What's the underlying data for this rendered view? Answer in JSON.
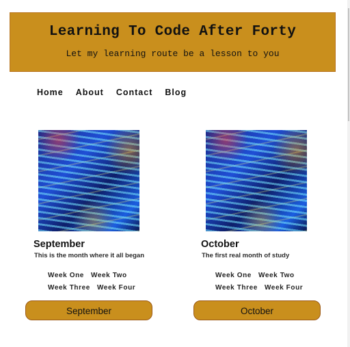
{
  "header": {
    "title": "Learning To Code After Forty",
    "subtitle": "Let my learning route be a lesson to you"
  },
  "nav": {
    "items": [
      {
        "label": "Home"
      },
      {
        "label": "About"
      },
      {
        "label": "Contact"
      },
      {
        "label": "Blog"
      }
    ]
  },
  "cards": [
    {
      "image_alt": "code-screen-image",
      "month": "September",
      "description": "This is the month where it all began",
      "weeks": [
        "Week One",
        "Week Two",
        "Week Three",
        "Week Four"
      ],
      "button_label": "September"
    },
    {
      "image_alt": "code-screen-image",
      "month": "October",
      "description": "The first real month of study",
      "weeks": [
        "Week One",
        "Week Two",
        "Week Three",
        "Week Four"
      ],
      "button_label": "October"
    }
  ],
  "colors": {
    "accent": "#c98f1d",
    "accent_border": "#b8731c",
    "text": "#111111"
  }
}
